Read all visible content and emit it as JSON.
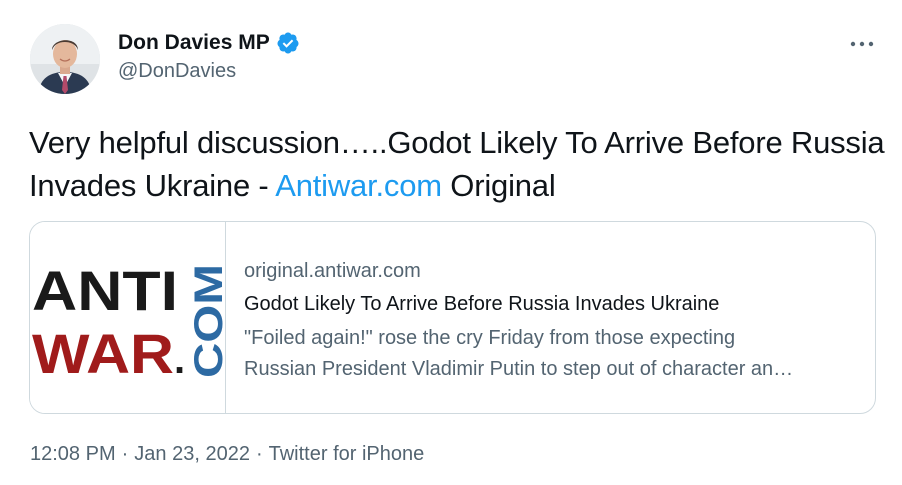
{
  "author": {
    "display_name": "Don Davies MP",
    "handle": "@DonDavies",
    "verified": true,
    "avatar": "profile-photo"
  },
  "more_icon": "more-horizontal-icon",
  "tweet": {
    "text_before_link": "Very helpful discussion…..Godot Likely To Arrive Before Russia Invades Ukraine - ",
    "link_text": "Antiwar.com",
    "text_after_link": " Original"
  },
  "card": {
    "logo_text_anti": "ANTI",
    "logo_text_war": "WAR",
    "logo_text_com": "COM",
    "logo_text_dot": ".",
    "domain": "original.antiwar.com",
    "title": "Godot Likely To Arrive Before Russia Invades Ukraine",
    "description_line1": "\"Foiled again!\" rose the cry Friday from those expecting",
    "description_line2": "Russian President Vladimir Putin to step out of character an…"
  },
  "meta": {
    "time": "12:08 PM",
    "separator": "·",
    "date": "Jan 23, 2022",
    "source": "Twitter for iPhone"
  },
  "colors": {
    "link": "#1d9bf0",
    "secondary_text": "#536471",
    "border": "#cfd9de",
    "logo_dark": "#1a1a1a",
    "logo_red": "#a01b1b",
    "logo_blue": "#2d6aa3"
  }
}
